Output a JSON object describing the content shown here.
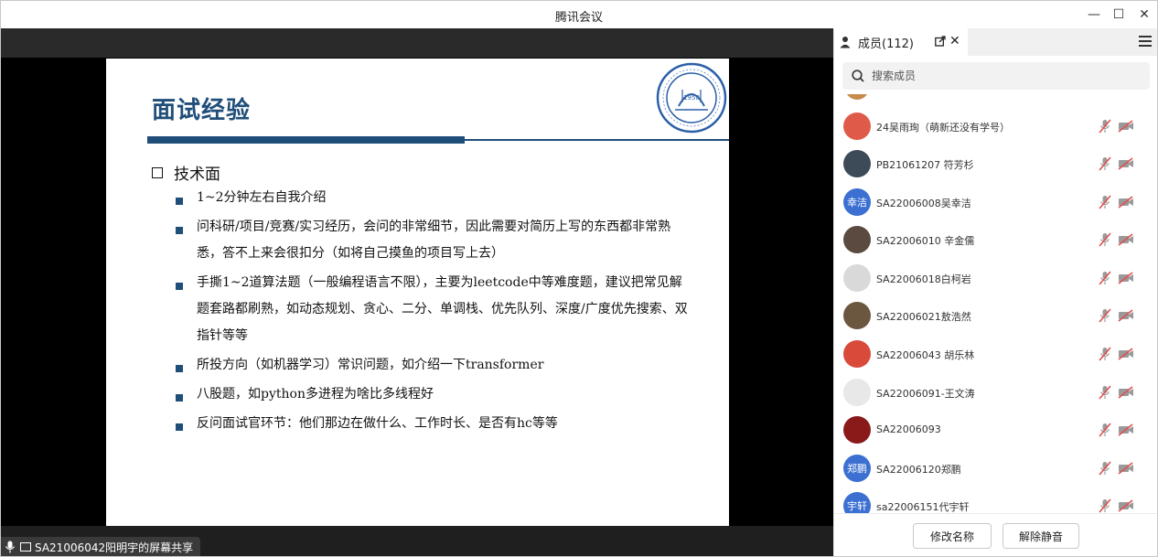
{
  "window": {
    "title": "腾讯会议",
    "minimize": "—",
    "maximize": "☐",
    "close": "✕"
  },
  "slide": {
    "title": "面试经验",
    "section": "技术面",
    "bullets": [
      "1~2分钟左右自我介绍",
      "问科研/项目/竞赛/实习经历，会问的非常细节，因此需要对简历上写的东西都非常熟悉，答不上来会很扣分（如将自己摸鱼的项目写上去）",
      "手撕1~2道算法题（一般编程语言不限），主要为leetcode中等难度题，建议把常见解题套路都刷熟，如动态规划、贪心、二分、单调栈、优先队列、深度/广度优先搜索、双指针等等",
      "所投方向（如机器学习）常识问题，如介绍一下transformer",
      "八股题，如python多进程为啥比多线程好",
      "反问面试官环节：他们那边在做什么、工作时长、是否有hc等等"
    ],
    "logo_year": "1958"
  },
  "share": {
    "label": "SA21006042阳明宇的屏幕共享"
  },
  "panel": {
    "tab_label": "成员(112)",
    "search_placeholder": "搜索成员",
    "members": [
      {
        "name": "24吴雨珣（萌新还没有学号）",
        "avatar_text": "",
        "avatar_color": "#e05a4a"
      },
      {
        "name": "PB21061207 符芳杉",
        "avatar_text": "",
        "avatar_color": "#3d4a57"
      },
      {
        "name": "SA22006008吴幸洁",
        "avatar_text": "幸洁",
        "avatar_color": "#3b6fd1"
      },
      {
        "name": "SA22006010 辛金儒",
        "avatar_text": "",
        "avatar_color": "#5a4a3f"
      },
      {
        "name": "SA22006018白柯岩",
        "avatar_text": "",
        "avatar_color": "#d9d9d9"
      },
      {
        "name": "SA22006021敖浩然",
        "avatar_text": "",
        "avatar_color": "#6b5640"
      },
      {
        "name": "SA22006043 胡乐林",
        "avatar_text": "",
        "avatar_color": "#d94a3a"
      },
      {
        "name": "SA22006091-王文涛",
        "avatar_text": "",
        "avatar_color": "#e8e8e8"
      },
      {
        "name": "SA22006093",
        "avatar_text": "",
        "avatar_color": "#8a1a1a"
      },
      {
        "name": "SA22006120郑鹏",
        "avatar_text": "郑鹏",
        "avatar_color": "#3b6fd1"
      },
      {
        "name": "sa22006151代宇轩",
        "avatar_text": "宇轩",
        "avatar_color": "#3b6fd1"
      }
    ],
    "rename_button": "修改名称",
    "unmute_button": "解除静音"
  },
  "colors": {
    "accent": "#1f4e79",
    "muted_mic": "#e05050"
  }
}
